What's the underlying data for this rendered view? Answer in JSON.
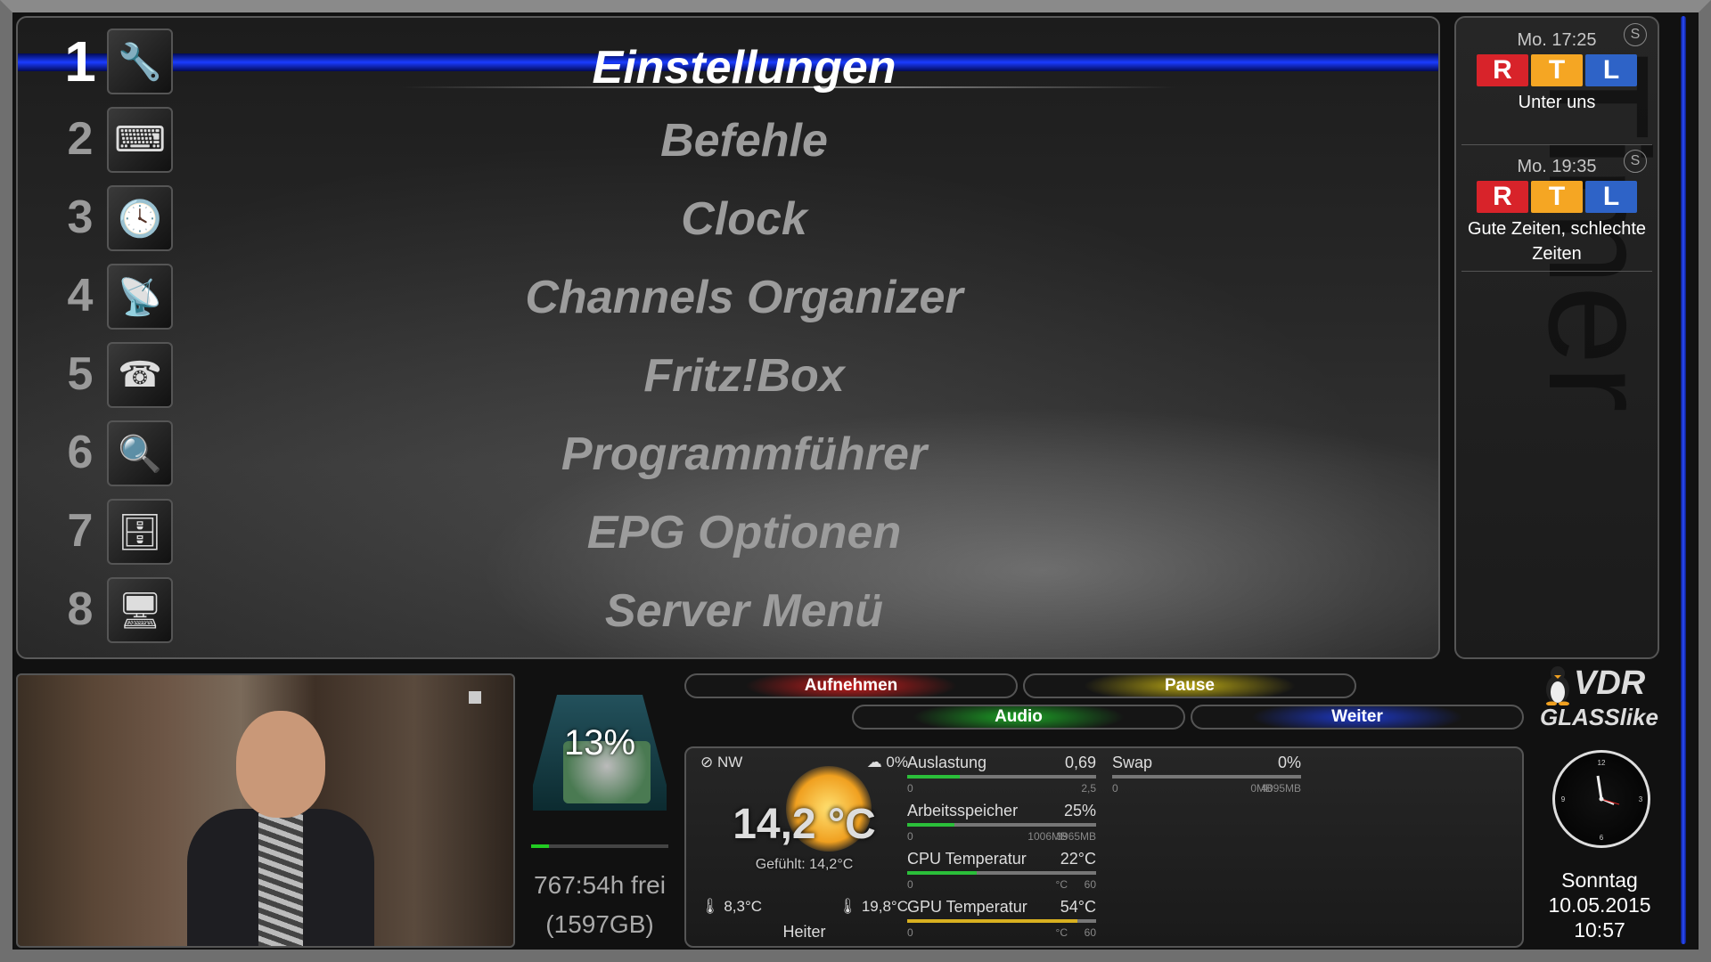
{
  "menu": {
    "items": [
      {
        "num": "1",
        "label": "Einstellungen",
        "icon": "tools-icon",
        "glyph": "🔧"
      },
      {
        "num": "2",
        "label": "Befehle",
        "icon": "keyboard-icon",
        "glyph": "⌨"
      },
      {
        "num": "3",
        "label": "Clock",
        "icon": "clock-icon",
        "glyph": "🕓"
      },
      {
        "num": "4",
        "label": "Channels Organizer",
        "icon": "satellite-dish-icon",
        "glyph": "📡"
      },
      {
        "num": "5",
        "label": "Fritz!Box",
        "icon": "fritzbox-icon",
        "glyph": "☎"
      },
      {
        "num": "6",
        "label": "Programmführer",
        "icon": "epg-guide-icon",
        "glyph": "🔍"
      },
      {
        "num": "7",
        "label": "EPG Optionen",
        "icon": "database-icon",
        "glyph": "🗄"
      },
      {
        "num": "8",
        "label": "Server Menü",
        "icon": "server-monitor-icon",
        "glyph": "🖥"
      }
    ],
    "selected_index": 0
  },
  "timers": {
    "watermark": "Timer",
    "entries": [
      {
        "time": "Mo. 17:25",
        "channel_logo": [
          "R",
          "T",
          "L"
        ],
        "title": "Unter uns",
        "badge": "S"
      },
      {
        "time": "Mo. 19:35",
        "channel_logo": [
          "R",
          "T",
          "L"
        ],
        "title": "Gute Zeiten, schlechte Zeiten",
        "badge": "S"
      }
    ],
    "logo_colors": [
      "#d8232a",
      "#f5a623",
      "#2e63c7"
    ]
  },
  "disk": {
    "percent": "13%",
    "usage_fraction": 0.13,
    "free_time": "767:54h frei",
    "free_size": "(1597GB)"
  },
  "buttons": {
    "red": "Aufnehmen",
    "yellow": "Pause",
    "green": "Audio",
    "blue": "Weiter"
  },
  "weather": {
    "wind": "NW",
    "precip": "0%",
    "temp": "14,2 °C",
    "feels_like": "Gefühlt: 14,2°C",
    "min": "8,3°C",
    "max": "19,8°C",
    "desc": "Heiter"
  },
  "system": {
    "load": {
      "name": "Auslastung",
      "value": "0,69",
      "fraction": 0.28,
      "min": "0",
      "max": "2,5",
      "color": "#2bbf3a"
    },
    "memory": {
      "name": "Arbeitsspeicher",
      "value": "25%",
      "fraction": 0.25,
      "min": "0",
      "mid": "1006MB",
      "max": "3965MB",
      "color": "#2bbf3a"
    },
    "cpu_temp": {
      "name": "CPU Temperatur",
      "value": "22°C",
      "fraction": 0.37,
      "min": "0",
      "mid": "°C",
      "max": "60",
      "color": "#2bbf3a"
    },
    "gpu_temp": {
      "name": "GPU Temperatur",
      "value": "54°C",
      "fraction": 0.9,
      "min": "0",
      "mid": "°C",
      "max": "60",
      "color": "#d8b020"
    },
    "swap": {
      "name": "Swap",
      "value": "0%",
      "fraction": 0.0,
      "min": "0",
      "mid": "0MB",
      "max": "4095MB",
      "color": "#2bbf3a"
    }
  },
  "branding": {
    "vdr": "VDR",
    "skin": "GLASSlike"
  },
  "datetime": {
    "weekday": "Sonntag",
    "date": "10.05.2015",
    "time": "10:57"
  }
}
